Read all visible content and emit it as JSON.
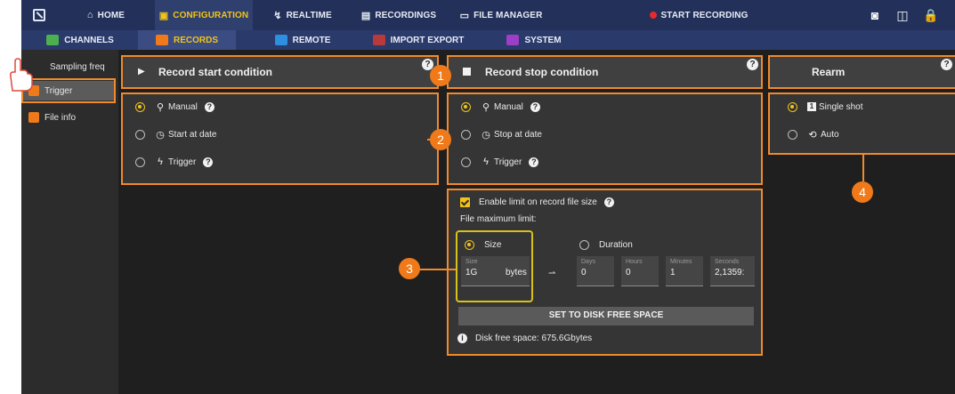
{
  "topnav": {
    "home": "HOME",
    "configuration": "CONFIGURATION",
    "realtime": "REALTIME",
    "recordings": "RECORDINGS",
    "file_manager": "FILE MANAGER",
    "start_recording": "START RECORDING",
    "active": "configuration",
    "icons": [
      "camera-icon",
      "book-icon",
      "lock-icon"
    ]
  },
  "subnav": {
    "channels": "CHANNELS",
    "records": "RECORDS",
    "remote": "REMOTE",
    "import_export": "IMPORT EXPORT",
    "system": "SYSTEM",
    "active": "records"
  },
  "sidebar": {
    "items": [
      {
        "label": "Sampling freq"
      },
      {
        "label": "Trigger",
        "selected": true
      },
      {
        "label": "File info"
      }
    ]
  },
  "start_panel": {
    "title": "Record start condition",
    "options": [
      {
        "label": "Manual",
        "selected": true
      },
      {
        "label": "Start at date",
        "selected": false
      },
      {
        "label": "Trigger",
        "selected": false
      }
    ]
  },
  "stop_panel": {
    "title": "Record stop condition",
    "options": [
      {
        "label": "Manual",
        "selected": true
      },
      {
        "label": "Stop at date",
        "selected": false
      },
      {
        "label": "Trigger",
        "selected": false
      }
    ]
  },
  "rearm_panel": {
    "title": "Rearm",
    "options": [
      {
        "label": "Single shot",
        "selected": true
      },
      {
        "label": "Auto",
        "selected": false
      }
    ]
  },
  "limit_panel": {
    "enable_label": "Enable limit on record file size",
    "enabled": true,
    "max_limit_label": "File maximum limit:",
    "size_option": "Size",
    "duration_option": "Duration",
    "size_field": {
      "label": "Size",
      "value": "1G",
      "unit": "bytes"
    },
    "duration_fields": [
      {
        "label": "Days",
        "value": "0"
      },
      {
        "label": "Hours",
        "value": "0"
      },
      {
        "label": "Minutes",
        "value": "1"
      },
      {
        "label": "Seconds",
        "value": "2,1359:"
      }
    ],
    "set_button": "SET TO DISK FREE SPACE",
    "disk_free": "Disk free space:  675.6Gbytes"
  },
  "badges": [
    "1",
    "2",
    "3",
    "4"
  ],
  "colors": {
    "accent": "#f2c418",
    "callout": "#f08a2c",
    "topbar": "#22305a",
    "record": "#e52b2b"
  }
}
